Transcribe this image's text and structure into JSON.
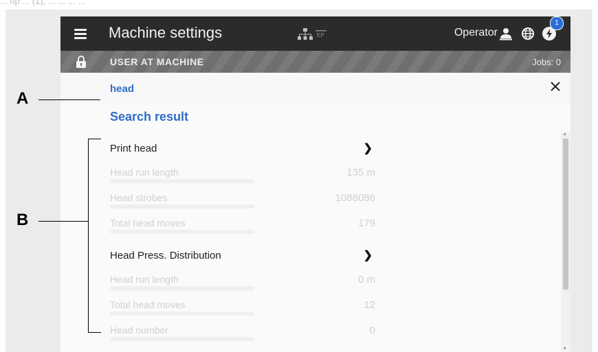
{
  "header": {
    "app_title": "Machine settings",
    "network_icon": "network-tree-icon",
    "network_tag": "EP",
    "role": "Operator",
    "notification_count": "1"
  },
  "status": {
    "label": "USER AT MACHINE",
    "jobs": "Jobs: 0"
  },
  "search": {
    "query": "head",
    "results_heading": "Search result"
  },
  "results": [
    {
      "label": "Print head",
      "value": "",
      "group": true
    },
    {
      "label": "Head run length",
      "value": "135 m",
      "group": false
    },
    {
      "label": "Head strobes",
      "value": "1088086",
      "group": false
    },
    {
      "label": "Total head moves",
      "value": "179",
      "group": false
    },
    {
      "label": "Head Press. Distribution",
      "value": "",
      "group": true
    },
    {
      "label": "Head run length",
      "value": "0 m",
      "group": false
    },
    {
      "label": "Total head moves",
      "value": "12",
      "group": false
    },
    {
      "label": "Head number",
      "value": "0",
      "group": false
    }
  ],
  "callouts": {
    "a": "A",
    "b": "B"
  },
  "top_strip_text": "... пр ... (1), ... ... ... ..."
}
